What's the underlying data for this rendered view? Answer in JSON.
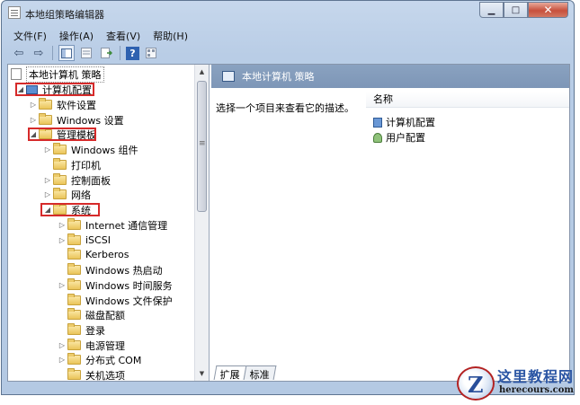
{
  "window": {
    "title": "本地组策略编辑器",
    "minimize_glyph": "▁",
    "maximize_glyph": "□",
    "close_glyph": "✕"
  },
  "menu": [
    "文件(F)",
    "操作(A)",
    "查看(V)",
    "帮助(H)"
  ],
  "toolbar": {
    "back_glyph": "⇦",
    "forward_glyph": "⇨",
    "help_glyph": "?",
    "icons": [
      "back-icon",
      "forward-icon",
      "show-hide-tree-icon",
      "properties-icon",
      "export-list-icon",
      "help-icon",
      "filter-icon"
    ]
  },
  "tree": {
    "root": "本地计算机 策略",
    "computer_config": "计算机配置",
    "software_settings": "软件设置",
    "windows_settings": "Windows 设置",
    "admin_templates": "管理模板",
    "windows_components": "Windows 组件",
    "printers": "打印机",
    "control_panel": "控制面板",
    "network": "网络",
    "system": "系统",
    "system_children": [
      {
        "label": "Internet 通信管理",
        "expandable": true
      },
      {
        "label": "iSCSI",
        "expandable": true
      },
      {
        "label": "Kerberos",
        "expandable": false
      },
      {
        "label": "Windows 热启动",
        "expandable": false
      },
      {
        "label": "Windows 时间服务",
        "expandable": true
      },
      {
        "label": "Windows 文件保护",
        "expandable": false
      },
      {
        "label": "磁盘配额",
        "expandable": false
      },
      {
        "label": "登录",
        "expandable": false
      },
      {
        "label": "电源管理",
        "expandable": true
      },
      {
        "label": "分布式 COM",
        "expandable": true
      },
      {
        "label": "关机选项",
        "expandable": false
      }
    ],
    "highlight_color": "#d62a2a"
  },
  "right": {
    "header": "本地计算机 策略",
    "description": "选择一个项目来查看它的描述。",
    "column_name": "名称",
    "items": [
      "计算机配置",
      "用户配置"
    ]
  },
  "tabs": [
    "扩展",
    "标准"
  ],
  "watermark": {
    "title": "这里教程网",
    "url": "herecours.com"
  }
}
